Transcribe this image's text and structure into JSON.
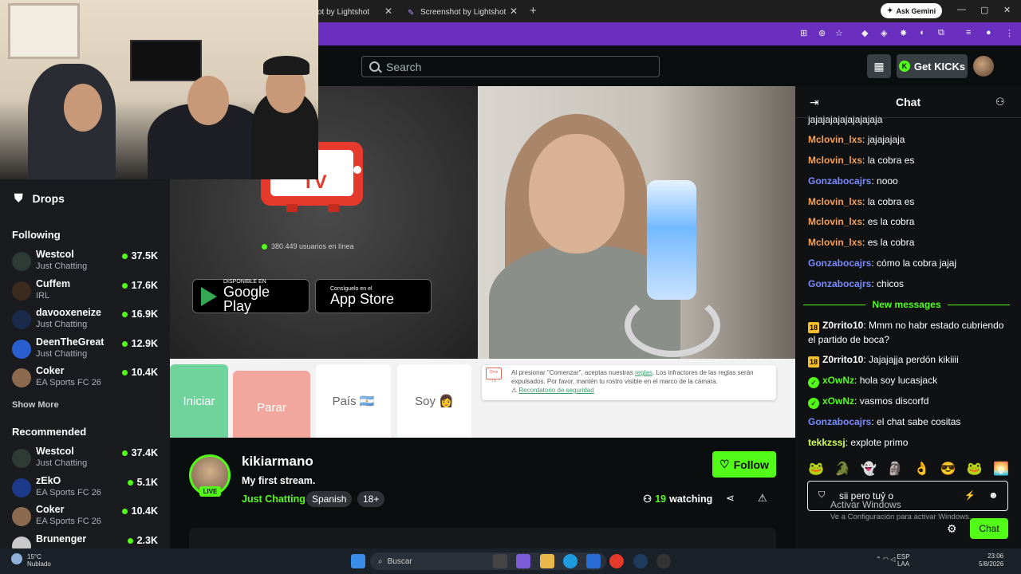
{
  "browser": {
    "tabs": [
      {
        "label": "ot by Lightshot"
      },
      {
        "label": "Screenshot by Lightshot"
      }
    ],
    "new_tab": "+",
    "ask_gemini": "Ask Gemini",
    "window_controls": [
      "—",
      "▢",
      "✕"
    ]
  },
  "header": {
    "search_placeholder": "Search",
    "get_kicks": "Get KICKs"
  },
  "sidebar": {
    "drops_label": "Drops",
    "following_title": "Following",
    "following": [
      {
        "name": "Westcol",
        "category": "Just Chatting",
        "viewers": "37.5K"
      },
      {
        "name": "Cuffem",
        "category": "IRL",
        "viewers": "17.6K"
      },
      {
        "name": "davooxeneize",
        "category": "Just Chatting",
        "viewers": "16.9K"
      },
      {
        "name": "DeenTheGreat",
        "category": "Just Chatting",
        "viewers": "12.9K"
      },
      {
        "name": "Coker",
        "category": "EA Sports FC 26",
        "viewers": "10.4K"
      }
    ],
    "show_more": "Show More",
    "recommended_title": "Recommended",
    "recommended": [
      {
        "name": "Westcol",
        "category": "Just Chatting",
        "viewers": "37.4K"
      },
      {
        "name": "zEkO",
        "category": "EA Sports FC 26",
        "viewers": "5.1K"
      },
      {
        "name": "Coker",
        "category": "EA Sports FC 26",
        "viewers": "10.4K"
      },
      {
        "name": "Brunenger",
        "category": "",
        "viewers": "2.3K"
      }
    ]
  },
  "video": {
    "tv_text": "TV",
    "online_count": "380.449 usuarios en línea",
    "google_play": {
      "top": "DISPONIBLE EN",
      "bottom": "Google Play"
    },
    "app_store": {
      "top": "Consíguelo en el",
      "bottom": "App Store"
    },
    "buttons": {
      "iniciar": "Iniciar",
      "parar": "Parar",
      "pais": "País 🇦🇷",
      "soy": "Soy 👩"
    },
    "notice_text_1": "Al presionar \"Comenzar\", aceptas nuestras ",
    "notice_link_1": "reglas",
    "notice_text_2": ". Los infractores de las reglas serán expulsados. Por favor, mantén tu rostro visible en el marco de la cámara.",
    "notice_link_2": "Recordatorio de seguridad",
    "notice_icon_text": "Ome TV"
  },
  "stream": {
    "name": "kikiarmano",
    "title": "My first stream.",
    "category": "Just Chatting",
    "tags": [
      "Spanish",
      "18+"
    ],
    "live": "LIVE",
    "follow": "Follow",
    "watching_count": "19",
    "watching_label": "watching"
  },
  "chat": {
    "title": "Chat",
    "messages": [
      {
        "user": "",
        "text": "jajajajajajajajajaja",
        "color": "#ffffff"
      },
      {
        "user": "Mclovin_lxs",
        "text": "jajajajaja",
        "color": "#f5a05b"
      },
      {
        "user": "Mclovin_lxs",
        "text": "la cobra es",
        "color": "#f5a05b"
      },
      {
        "user": "Gonzabocajrs",
        "text": "nooo",
        "color": "#7b8bff"
      },
      {
        "user": "Mclovin_lxs",
        "text": "la cobra es",
        "color": "#f5a05b"
      },
      {
        "user": "Mclovin_lxs",
        "text": "es la cobra",
        "color": "#f5a05b"
      },
      {
        "user": "Mclovin_lxs",
        "text": "es la cobra",
        "color": "#f5a05b"
      },
      {
        "user": "Gonzabocajrs",
        "text": "cómo la cobra jajaj",
        "color": "#7b8bff"
      },
      {
        "user": "Gonzabocajrs",
        "text": "chicos",
        "color": "#7b8bff"
      }
    ],
    "new_messages": "New messages",
    "new": [
      {
        "badge": "18",
        "user": "Z0rrito10",
        "text": "Mmm no habr estado cubriendo el partido de boca?",
        "color": "#ffffff"
      },
      {
        "badge": "18",
        "user": "Z0rrito10",
        "text": "Jajajajja perdón kikiiii",
        "color": "#ffffff"
      },
      {
        "badge": "v",
        "user": "xOwNz",
        "text": "hola soy lucasjack",
        "color": "#53fc18"
      },
      {
        "badge": "v",
        "user": "xOwNz",
        "text": "vasmos discorfd",
        "color": "#53fc18"
      },
      {
        "badge": "",
        "user": "Gonzabocajrs",
        "text": "el chat sabe cositas",
        "color": "#7b8bff"
      },
      {
        "badge": "",
        "user": "tekkzssj",
        "text": "explote primo",
        "color": "#d3ff5c"
      }
    ],
    "input_value": "sii pero tuỷ o",
    "send": "Chat",
    "watermark_1": "Activar Windows",
    "watermark_2": "Ve a Configuración para activar Windows."
  },
  "taskbar": {
    "temp": "15°C",
    "weather": "Nublado",
    "search": "Buscar",
    "lang_1": "ESP",
    "lang_2": "LAA",
    "time": "23:06",
    "date": "5/8/2026"
  }
}
